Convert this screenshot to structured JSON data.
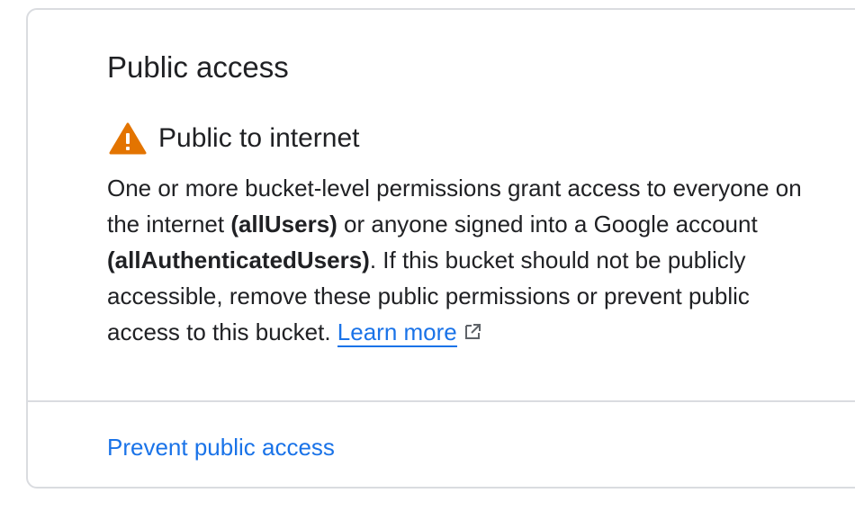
{
  "card": {
    "title": "Public access",
    "status": {
      "icon": "warning-icon",
      "icon_color": "#e37400",
      "label": "Public to internet"
    },
    "description": {
      "part1": "One or more bucket-level permissions grant access to everyone on the internet ",
      "bold1": "(allUsers)",
      "part2": " or anyone signed into a Google account ",
      "bold2": "(allAuthenticatedUsers)",
      "part3": ". If this bucket should not be publicly accessible, remove these public permissions or prevent public access to this bucket. ",
      "link_label": "Learn more",
      "link_icon": "external-link-icon"
    },
    "action_label": "Prevent public access",
    "link_color": "#1a73e8"
  }
}
